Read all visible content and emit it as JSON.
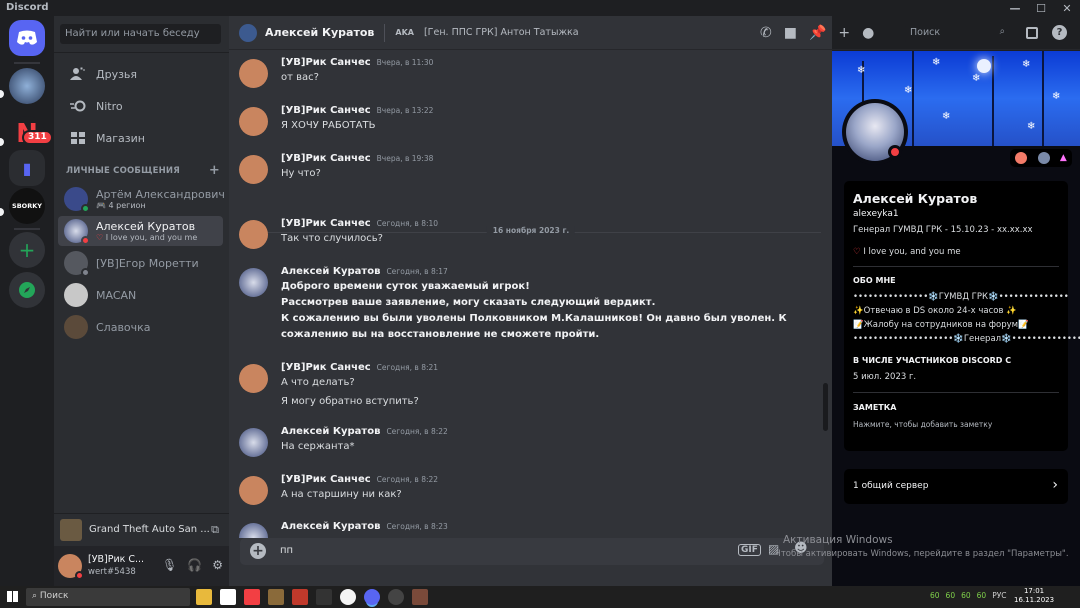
{
  "window": {
    "title": "Discord"
  },
  "sidebar": {
    "search_placeholder": "Найти или начать беседу",
    "nav": [
      {
        "label": "Друзья"
      },
      {
        "label": "Nitro"
      },
      {
        "label": "Магазин"
      }
    ],
    "dm_header": "ЛИЧНЫЕ СООБЩЕНИЯ",
    "dms": [
      {
        "name": "Артём Александрович",
        "sub": "4 регион"
      },
      {
        "name": "Алексей Куратов",
        "sub": "I love you, and you me"
      },
      {
        "name": "[УВ]Егор Моретти",
        "sub": ""
      },
      {
        "name": "MACAN",
        "sub": ""
      },
      {
        "name": "Славочка",
        "sub": ""
      }
    ],
    "activity": "Grand Theft Auto San ...",
    "user": {
      "name": "[УВ]Рик С...",
      "tag": "wert#5438"
    }
  },
  "rail": {
    "badge": "311",
    "server_label": "SBORKY"
  },
  "header": {
    "name": "Алексей Куратов",
    "aka": "AKA",
    "alias": "[Ген. ППС ГРК] Антон Татыжка",
    "search_placeholder": "Поиск"
  },
  "messages": [
    {
      "author": "[УВ]Рик Санчес",
      "time": "Вчера, в 11:30",
      "lines": [
        "от вас?"
      ]
    },
    {
      "author": "[УВ]Рик Санчес",
      "time": "Вчера, в 13:22",
      "lines": [
        "Я ХОЧУ РАБОТАТЬ"
      ]
    },
    {
      "author": "[УВ]Рик Санчес",
      "time": "Вчера, в 19:38",
      "lines": [
        "Ну что?"
      ]
    },
    {
      "author": "[УВ]Рик Санчес",
      "time": "Сегодня, в 8:10",
      "lines": [
        "Так что случилось?"
      ]
    },
    {
      "author": "Алексей Куратов",
      "time": "Сегодня, в 8:17",
      "lines": [
        "Доброго времени суток уважаемый игрок!",
        "Рассмотрев ваше заявление, могу сказать следующий вердикт.",
        "К сожалению вы были уволены Полковником М.Калашников! Он давно был уволен. К",
        "сожалению вы на восстановление не сможете пройти."
      ]
    },
    {
      "author": "[УВ]Рик Санчес",
      "time": "Сегодня, в 8:21",
      "lines": [
        "А что делать?",
        "Я могу обратно вступить?"
      ]
    },
    {
      "author": "Алексей Куратов",
      "time": "Сегодня, в 8:22",
      "lines": [
        "На сержанта*"
      ]
    },
    {
      "author": "[УВ]Рик Санчес",
      "time": "Сегодня, в 8:22",
      "lines": [
        "А на старшину ни как?"
      ]
    },
    {
      "author": "Алексей Куратов",
      "time": "Сегодня, в 8:23",
      "lines": []
    }
  ],
  "date_divider": "16 ноября 2023 г.",
  "composer": {
    "value": "пп",
    "gif": "GIF"
  },
  "profile": {
    "name": "Алексей Куратов",
    "username": "alexeyka1",
    "pronouns": "Генерал ГУМВД ГРК - 15.10.23 - xx.xx.xx",
    "status": "I love you, and you me",
    "about_header": "ОБО МНЕ",
    "about": [
      "•••••••••••••••❄️ГУМВД ГРК❄️••••••••••••••",
      "✨Отвечаю в DS около 24-х  часов ✨",
      "📝Жалобу на сотрудников на форум📝",
      "••••••••••••••••••••❄️Генерал❄️•••••••••••••••••••"
    ],
    "member_header": "В ЧИСЛЕ УЧАСТНИКОВ DISCORD С",
    "member_since": "5 июл. 2023 г.",
    "note_header": "ЗАМЕТКА",
    "note_placeholder": "Нажмите, чтобы добавить заметку",
    "mutual": "1 общий сервер"
  },
  "watermark": {
    "title": "Активация Windows",
    "sub": "Чтобы активировать Windows, перейдите в раздел \"Параметры\"."
  },
  "taskbar": {
    "search": "Поиск",
    "tray": [
      "60",
      "60",
      "60",
      "60",
      "РУС"
    ],
    "time": "17:01",
    "date": "16.11.2023"
  }
}
